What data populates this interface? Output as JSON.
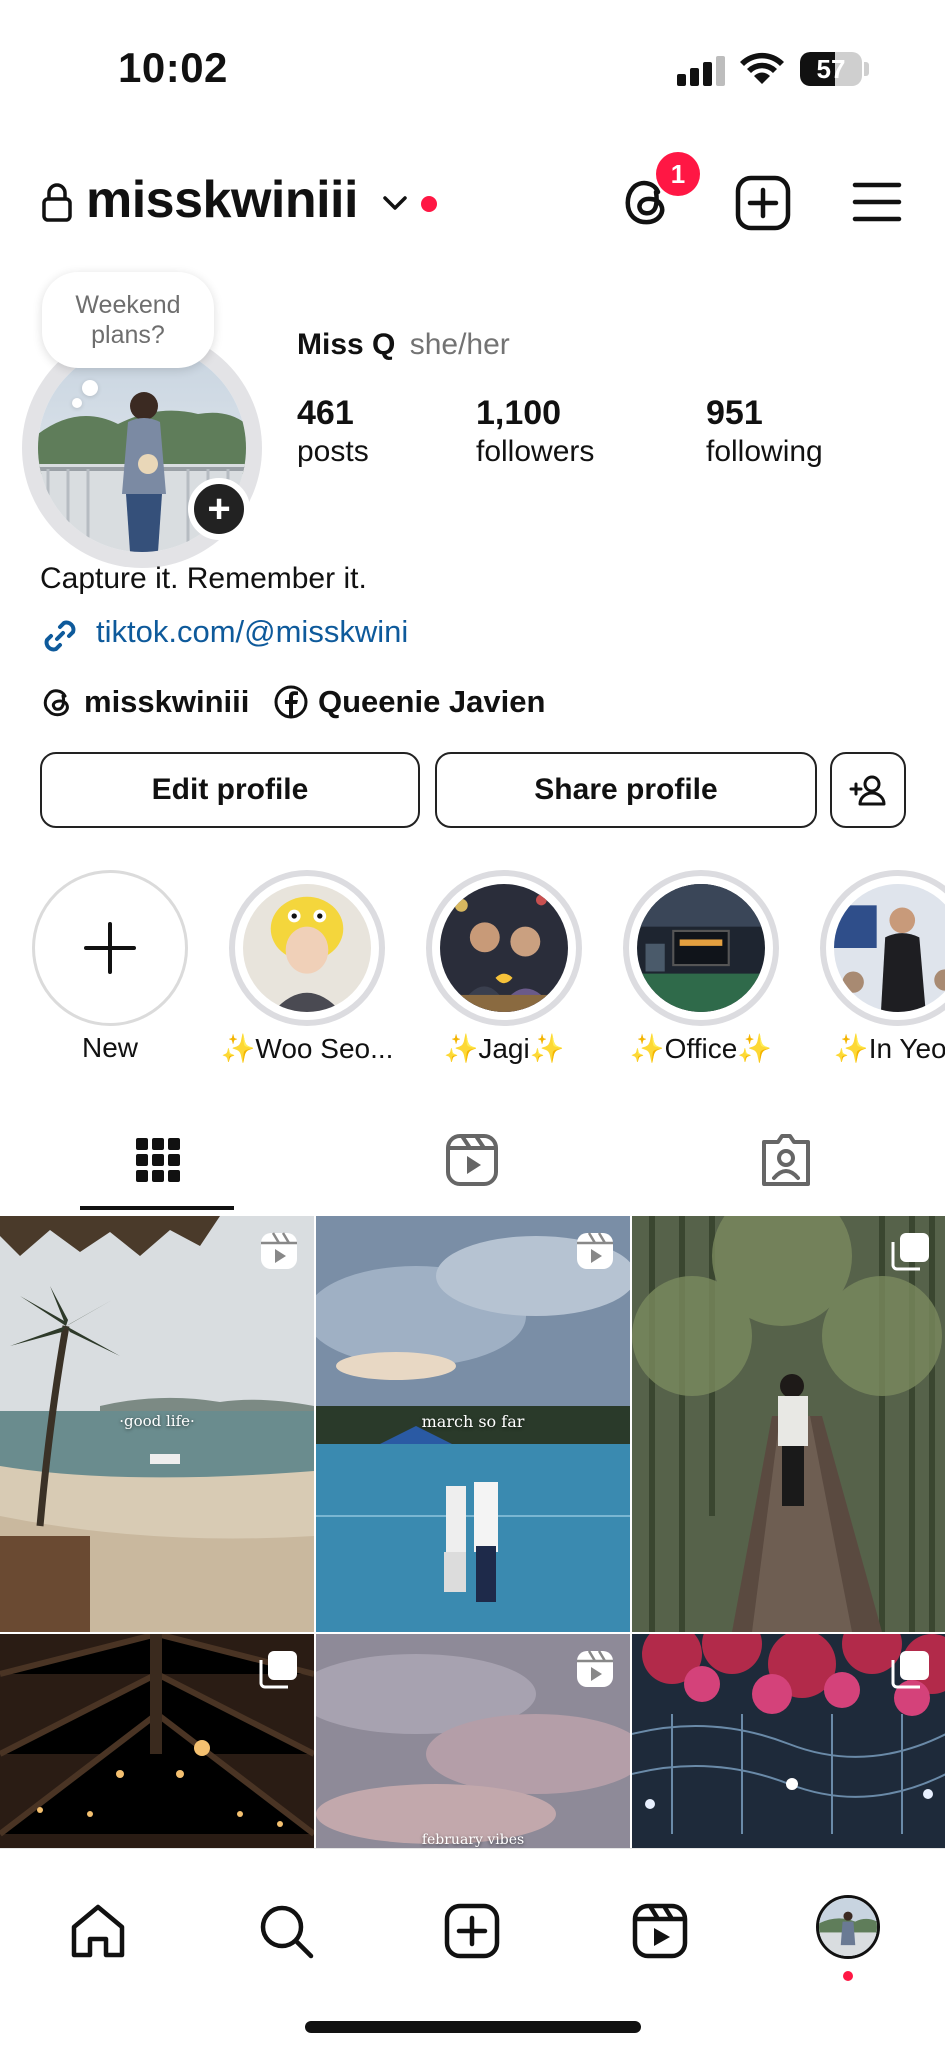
{
  "status_bar": {
    "time": "10:02",
    "battery": "57",
    "battery_level": 0.57
  },
  "header": {
    "username": "misskwiniii",
    "notification_count": "1"
  },
  "profile": {
    "note": "Weekend plans?",
    "display_name": "Miss Q",
    "pronouns": "she/her",
    "stats": [
      {
        "value": "461",
        "label": "posts"
      },
      {
        "value": "1,100",
        "label": "followers"
      },
      {
        "value": "951",
        "label": "following"
      }
    ],
    "bio": "Capture it. Remember it.",
    "link": "tiktok.com/@misskwini",
    "threads_handle": "misskwiniii",
    "facebook_name": "Queenie Javien"
  },
  "actions": {
    "edit": "Edit profile",
    "share": "Share profile"
  },
  "highlights": [
    {
      "label": "New"
    },
    {
      "label": "✨Woo Seo..."
    },
    {
      "label": "✨Jagi✨"
    },
    {
      "label": "✨Office✨"
    },
    {
      "label": "✨In Yeop"
    }
  ],
  "grid": {
    "captions": [
      "·good life·",
      "march so far",
      "february vibes"
    ]
  },
  "colors": {
    "accent_red": "#ff1744",
    "link_blue": "#0e5a9b"
  },
  "icons": {
    "tabs": [
      "grid-icon",
      "reels-icon",
      "tagged-icon"
    ],
    "nav": [
      "home-icon",
      "search-icon",
      "create-icon",
      "reels-icon",
      "profile-avatar"
    ]
  }
}
